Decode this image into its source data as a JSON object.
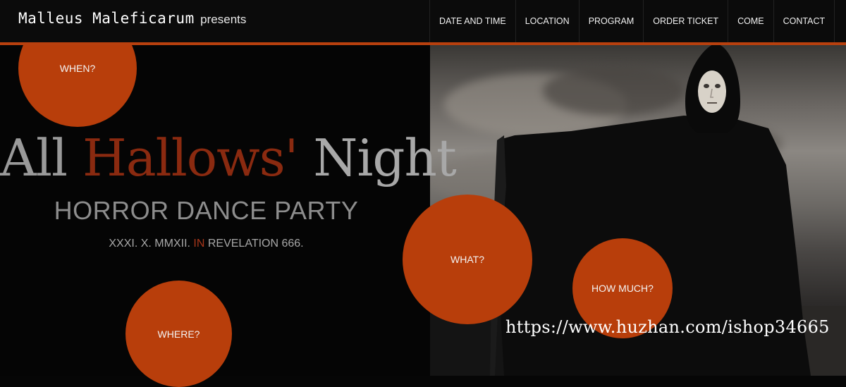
{
  "header": {
    "brand_name": "Malleus Maleficarum",
    "brand_tagline": "presents",
    "nav": [
      {
        "label": "DATE AND TIME"
      },
      {
        "label": "LOCATION"
      },
      {
        "label": "PROGRAM"
      },
      {
        "label": "ORDER TICKET"
      },
      {
        "label": "COME"
      },
      {
        "label": "CONTACT"
      }
    ]
  },
  "hero": {
    "title_part1": "All",
    "title_part2": "Hallows'",
    "title_part3": "Night",
    "subtitle": "HORROR DANCE PARTY",
    "date_before": "XXXI. X. MMXII.",
    "date_in": "IN",
    "date_after": "REVELATION 666."
  },
  "circles": {
    "when": "WHEN?",
    "where": "WHERE?",
    "what": "WHAT?",
    "how_much": "HOW MUCH?"
  },
  "watermark": "https://www.huzhan.com/ishop34665",
  "colors": {
    "accent": "#b83e0b",
    "background": "#060606",
    "title_red": "#8a2a10"
  }
}
